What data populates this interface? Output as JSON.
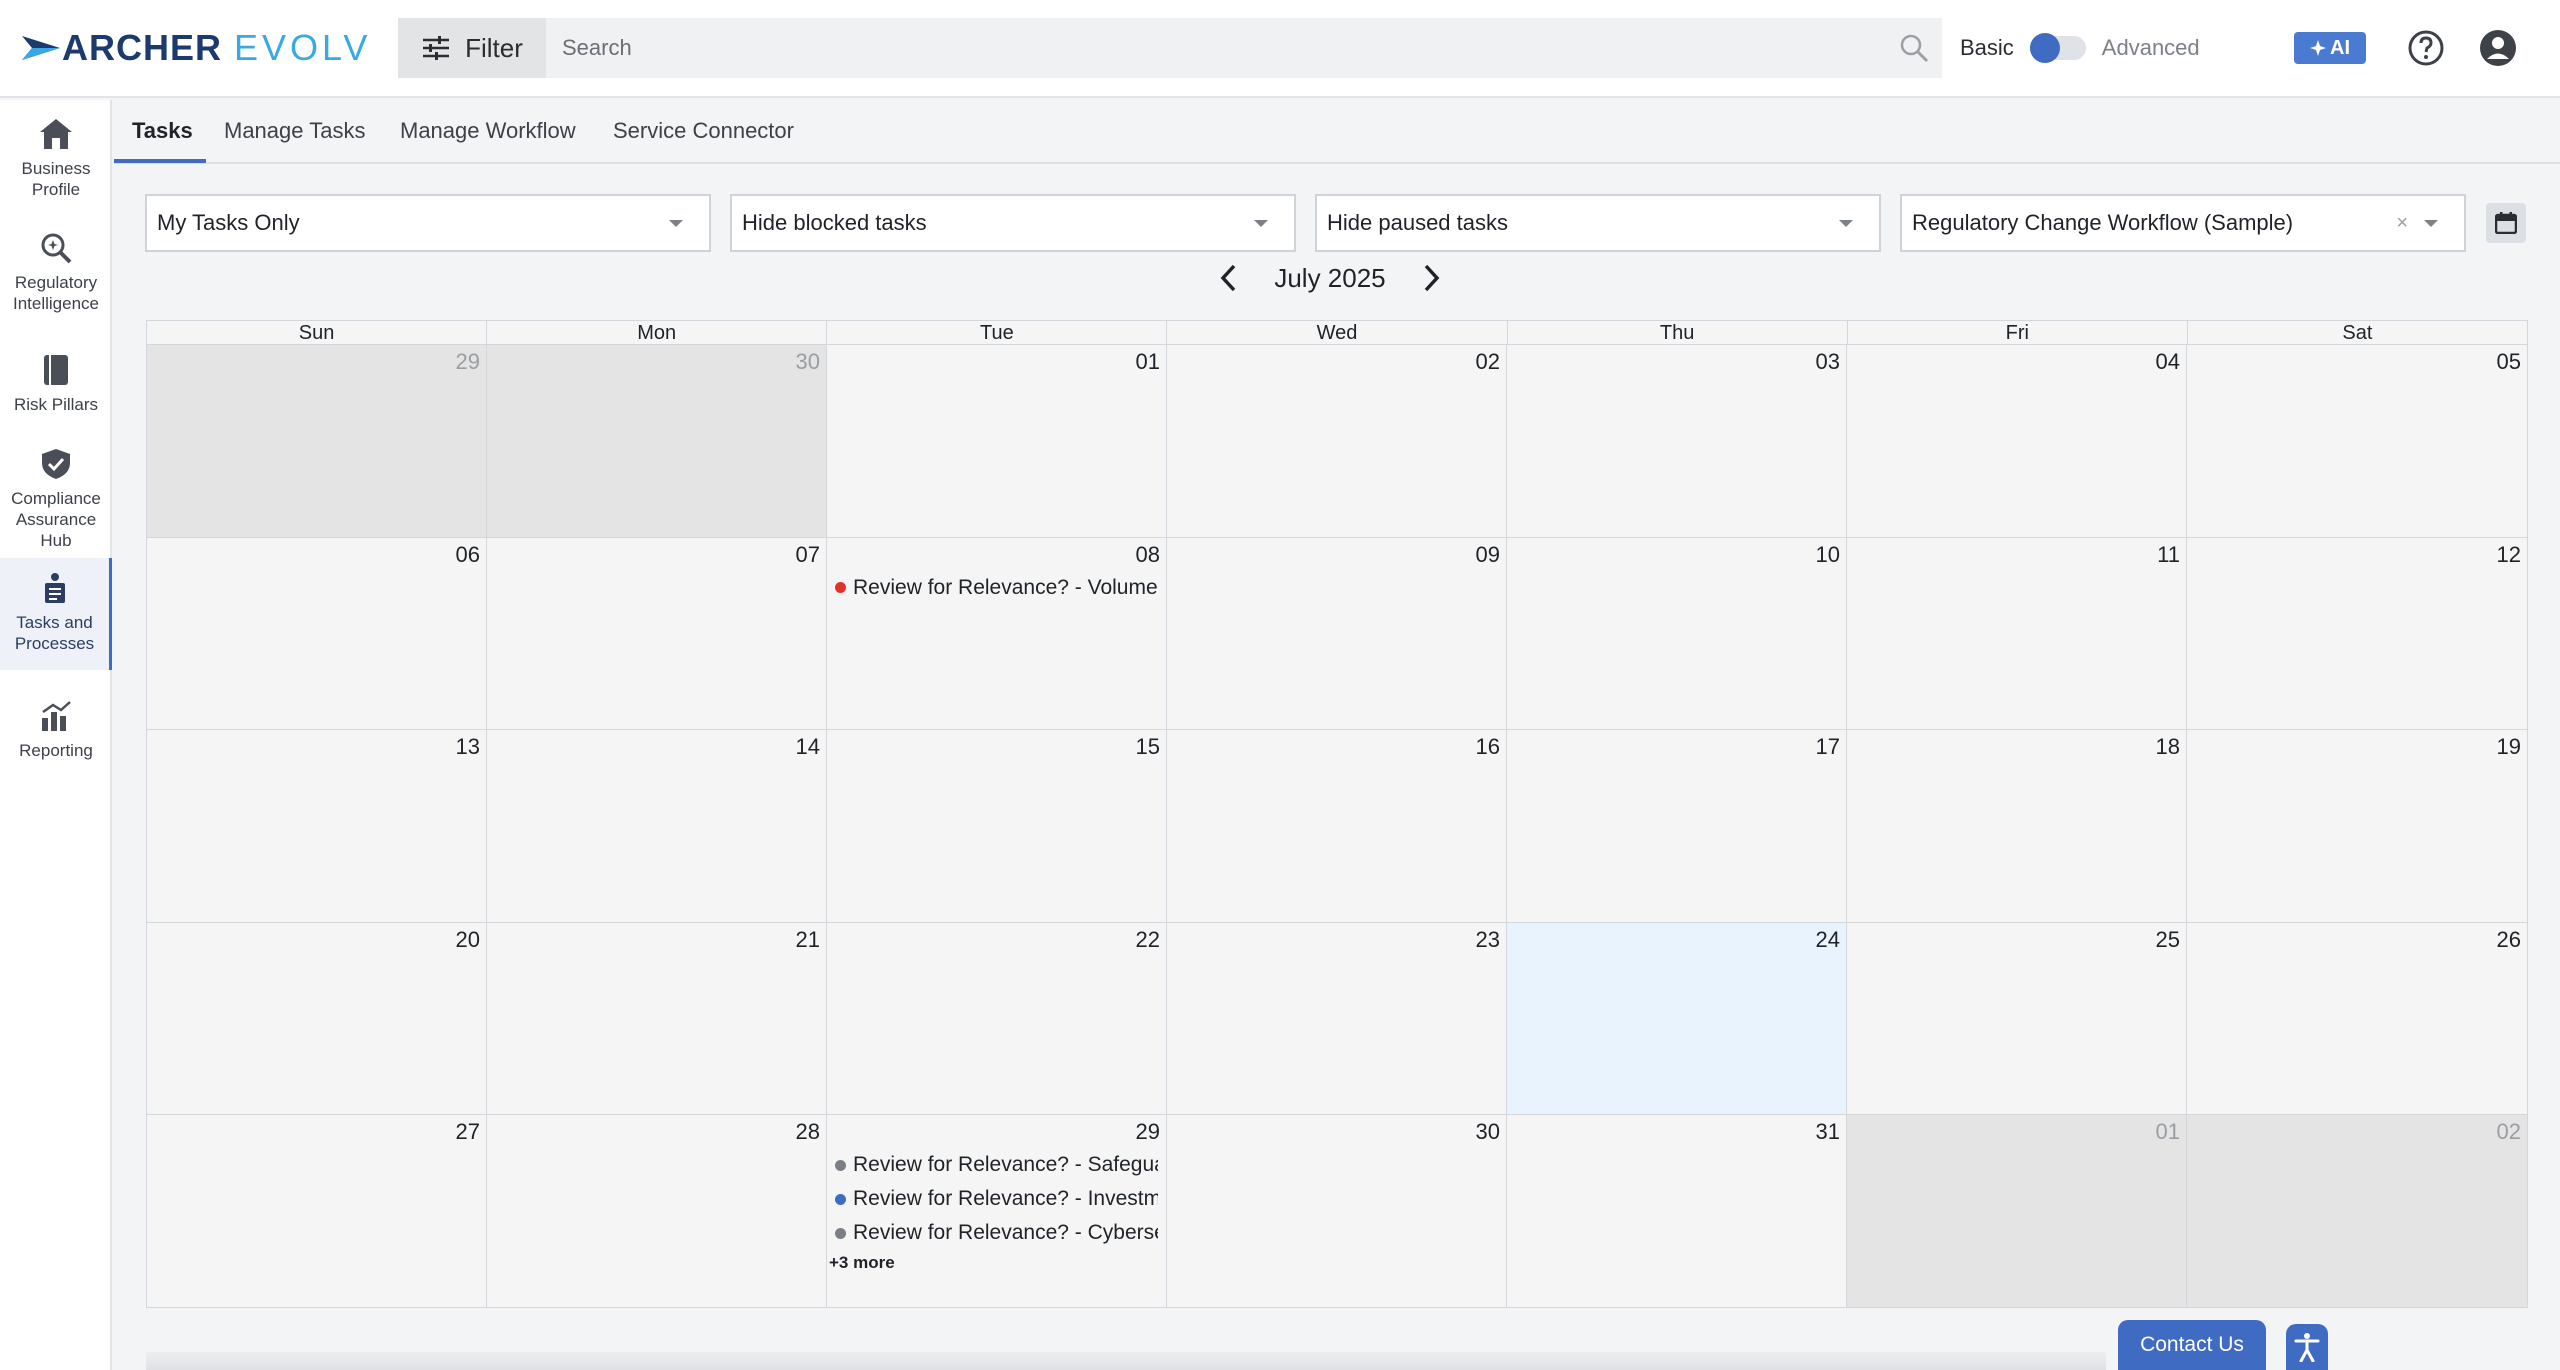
{
  "header": {
    "logo": {
      "part1": "ARCHER",
      "part2": "EVOLV"
    },
    "filter_label": "Filter",
    "search_placeholder": "Search",
    "mode_basic": "Basic",
    "mode_advanced": "Advanced",
    "ai_label": "AI"
  },
  "sidebar": {
    "items": [
      {
        "label": "Business Profile",
        "icon": "home-icon"
      },
      {
        "label": "Regulatory Intelligence",
        "icon": "search-icon"
      },
      {
        "label": "Risk Pillars",
        "icon": "book-icon"
      },
      {
        "label": "Compliance Assurance Hub",
        "icon": "shield-check-icon"
      },
      {
        "label": "Tasks and Processes",
        "icon": "tasks-icon",
        "active": true
      },
      {
        "label": "Reporting",
        "icon": "chart-icon"
      }
    ]
  },
  "tabs": [
    {
      "label": "Tasks",
      "active": true
    },
    {
      "label": "Manage Tasks"
    },
    {
      "label": "Manage Workflow"
    },
    {
      "label": "Service Connector"
    }
  ],
  "filters": {
    "assignee": "My Tasks Only",
    "blocked": "Hide blocked tasks",
    "paused": "Hide paused tasks",
    "workflow": "Regulatory Change Workflow (Sample)",
    "workflow_clear": "×"
  },
  "calendar": {
    "month_label": "July 2025",
    "weekdays": [
      "Sun",
      "Mon",
      "Tue",
      "Wed",
      "Thu",
      "Fri",
      "Sat"
    ],
    "days": [
      {
        "d": "29",
        "other": true
      },
      {
        "d": "30",
        "other": true
      },
      {
        "d": "01"
      },
      {
        "d": "02"
      },
      {
        "d": "03"
      },
      {
        "d": "04"
      },
      {
        "d": "05"
      },
      {
        "d": "06"
      },
      {
        "d": "07"
      },
      {
        "d": "08",
        "events": [
          {
            "text": "Review for Relevance? - Volume",
            "color": "#e0332b"
          }
        ]
      },
      {
        "d": "09"
      },
      {
        "d": "10"
      },
      {
        "d": "11"
      },
      {
        "d": "12"
      },
      {
        "d": "13"
      },
      {
        "d": "14"
      },
      {
        "d": "15"
      },
      {
        "d": "16"
      },
      {
        "d": "17"
      },
      {
        "d": "18"
      },
      {
        "d": "19"
      },
      {
        "d": "20"
      },
      {
        "d": "21"
      },
      {
        "d": "22"
      },
      {
        "d": "23"
      },
      {
        "d": "24",
        "today": true
      },
      {
        "d": "25"
      },
      {
        "d": "26"
      },
      {
        "d": "27"
      },
      {
        "d": "28"
      },
      {
        "d": "29",
        "events": [
          {
            "text": "Review for Relevance? - Safeguard",
            "color": "#7b7f85"
          },
          {
            "text": "Review for Relevance? - Investment",
            "color": "#3f6cc2"
          },
          {
            "text": "Review for Relevance? - Cybersecurity",
            "color": "#7b7f85"
          }
        ],
        "more": "+3 more"
      },
      {
        "d": "30"
      },
      {
        "d": "31"
      },
      {
        "d": "01",
        "other": true
      },
      {
        "d": "02",
        "other": true
      }
    ]
  },
  "footer": {
    "contact_label": "Contact Us"
  },
  "colors": {
    "accent": "#3f6cc2",
    "today_bg": "#e9f3fd",
    "event_red": "#e0332b",
    "event_blue": "#3f6cc2",
    "event_gray": "#7b7f85"
  }
}
